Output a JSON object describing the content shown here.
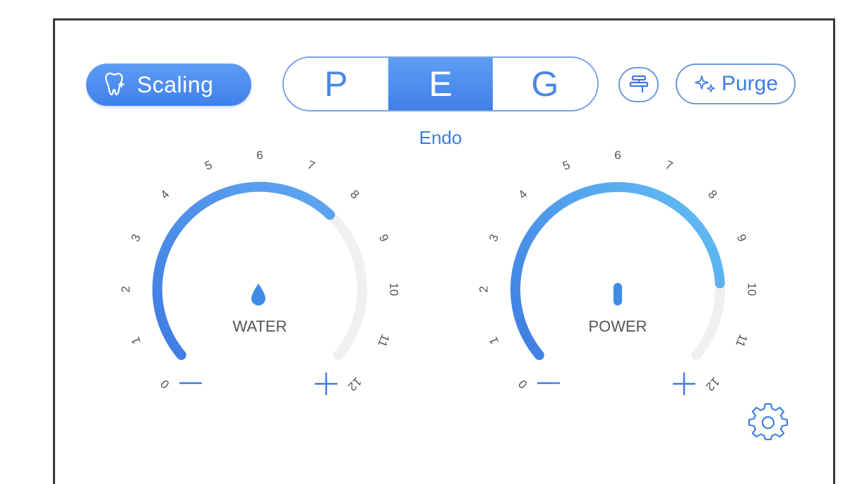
{
  "header": {
    "scaling_label": "Scaling",
    "modes": [
      "P",
      "E",
      "G"
    ],
    "active_mode": "E",
    "mode_name": "Endo",
    "purge_label": "Purge"
  },
  "dials": {
    "water": {
      "label": "WATER",
      "level": 8,
      "max": 12,
      "icon": "water-drop-icon"
    },
    "power": {
      "label": "POWER",
      "level": 10,
      "max": 12,
      "icon": "power-bar-icon"
    }
  },
  "scale_ticks": [
    "0",
    "1",
    "2",
    "3",
    "4",
    "5",
    "6",
    "7",
    "8",
    "9",
    "10",
    "11",
    "12"
  ],
  "controls": {
    "minus": "−",
    "plus": "+"
  },
  "colors": {
    "accent": "#3f7ce3",
    "accent_light": "#62b6f0",
    "track": "#f0f0f0"
  }
}
